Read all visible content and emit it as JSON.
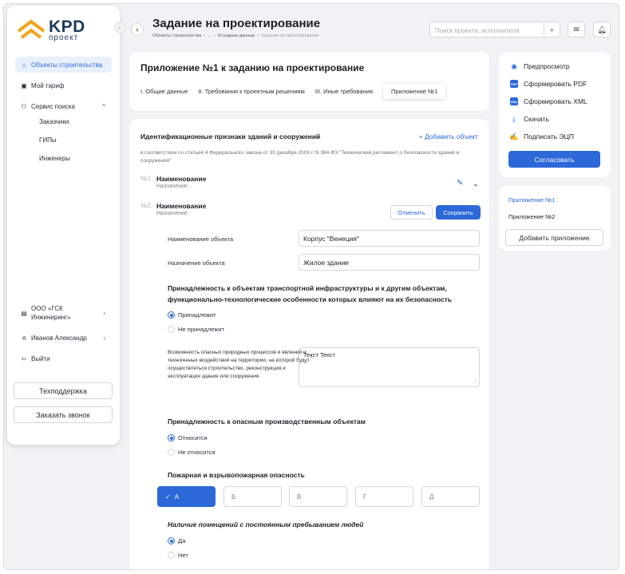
{
  "colors": {
    "accent": "#2c68d8",
    "logo_orange": "#f0a31c",
    "logo_navy": "#1d3a5c"
  },
  "logo": {
    "big": "KPD",
    "small": "проект"
  },
  "sidebar": {
    "items": [
      {
        "label": "Объекты строительства",
        "icon": "home-icon"
      },
      {
        "label": "Мой тариф",
        "icon": "tariff-icon"
      },
      {
        "label": "Сервис поиска",
        "icon": "people-search-icon"
      }
    ],
    "subitems": [
      "Заказчики",
      "ГИПы",
      "Инженеры"
    ],
    "company": "ООО «ГСК Инжиниринг»",
    "user": "Иванов Александр",
    "logout": "Выйти",
    "support": "Техподдержка",
    "callback": "Заказать звонок"
  },
  "header": {
    "title": "Задание на проектирование",
    "breadcrumbs": [
      "Объекты строительства",
      "•",
      "...",
      "•",
      "Исходные данные",
      "•",
      "Задание на проектирование"
    ],
    "search_placeholder": "Поиск проекта, исполнителя"
  },
  "main": {
    "title": "Приложение №1 к заданию на проектирование",
    "tabs": [
      "I. Общие данные",
      "II. Требования к проектным решениям",
      "III. Иные требования",
      "Приложение №1"
    ],
    "section_title": "Идентификационные признаки зданий и сооружений",
    "add_object": "+ Добавить объект",
    "note": "в соответствии со статьей 4 Федерального закона от 30 декабря 2009 г. N 384-ФЗ \"Технический регламент о безопасности зданий и сооружений\"",
    "objects": [
      {
        "num": "№1",
        "name": "Наименование",
        "sub": "Назначение"
      },
      {
        "num": "№2",
        "name": "Наименование",
        "sub": "Назначение"
      }
    ],
    "cancel": "Отменить",
    "save": "Сохранить",
    "fields": [
      {
        "label": "Наименование объекта",
        "value": "Корпус \"Венеция\""
      },
      {
        "label": "Назначение объекта",
        "value": "Жилое здание"
      }
    ],
    "q1": {
      "title": "Принадлежность к объектам транспортной инфраструктуры и к другим объектам, функционально-технологические особенности которых влияют на их безопасность",
      "options": [
        "Принадлежит",
        "Не принадлежит"
      ],
      "selected": 0
    },
    "hazard_label": "Возможность опасных природных процессов и явлений и техногенных воздействий на территории, на которой будут осуществляться строительство, реконструкция и эксплуатация здания или сооружения",
    "hazard_value": "Текст Текст",
    "q2": {
      "title": "Принадлежность к опасным производственным объектам",
      "options": [
        "Относится",
        "Не относится"
      ],
      "selected": 0
    },
    "fire": {
      "title": "Пожарная и взрывопожарная опасность",
      "options": [
        "А",
        "Б",
        "В",
        "Г",
        "Д"
      ],
      "selected": 0
    },
    "q3": {
      "title": "Наличие помещений с постоянным пребыванием людей",
      "options": [
        "Да",
        "Нет"
      ],
      "selected": 0
    }
  },
  "right": {
    "actions": [
      {
        "label": "Предпросмотр",
        "icon": "eye-icon"
      },
      {
        "label": "Сформировать PDF",
        "icon": "pdf-icon"
      },
      {
        "label": "Сформировать XML",
        "icon": "xml-icon"
      },
      {
        "label": "Скачать",
        "icon": "download-icon"
      },
      {
        "label": "Подписать ЭЦП",
        "icon": "sign-icon"
      }
    ],
    "approve": "Согласовать",
    "attachments": [
      "Приложение №1",
      "Приложение №2"
    ],
    "add_attachment": "Добавить приложение"
  }
}
